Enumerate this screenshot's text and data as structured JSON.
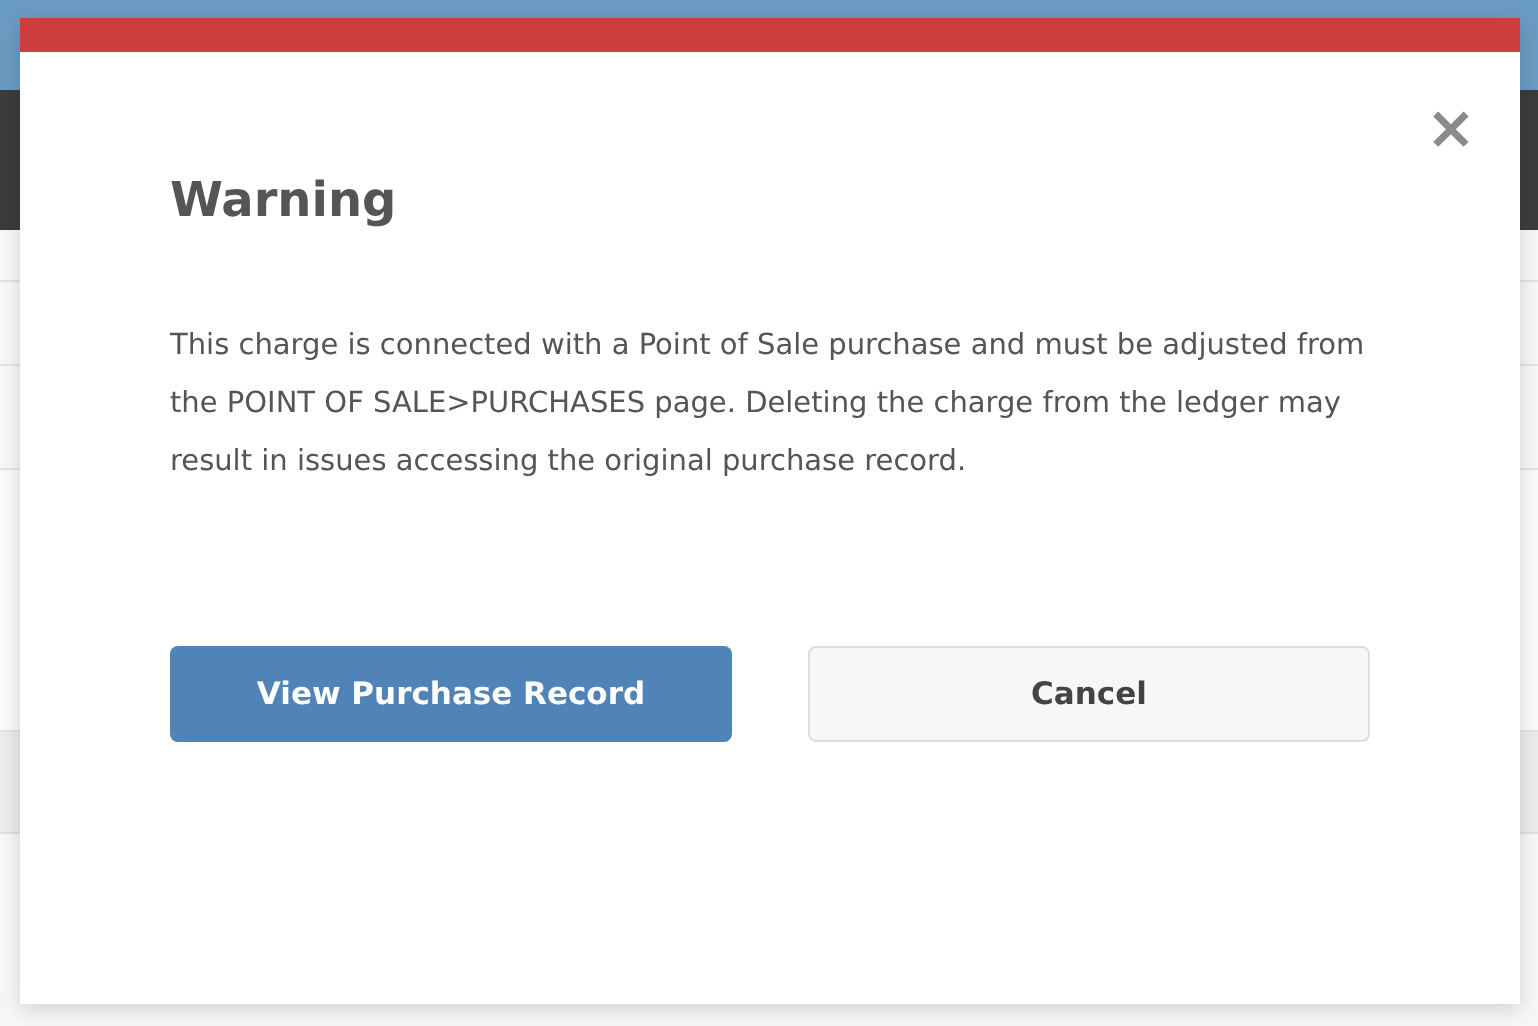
{
  "dialog": {
    "title": "Warning",
    "close": "×",
    "message": "This charge is connected with a Point of Sale purchase and must be adjusted from the POINT OF SALE>PURCHASES page. Deleting the charge from the ledger may result in issues accessing the original purchase record.",
    "buttons": [
      {
        "label": "View Purchase Record",
        "kind": "primary"
      },
      {
        "label": "Cancel",
        "kind": "secondary"
      }
    ]
  }
}
